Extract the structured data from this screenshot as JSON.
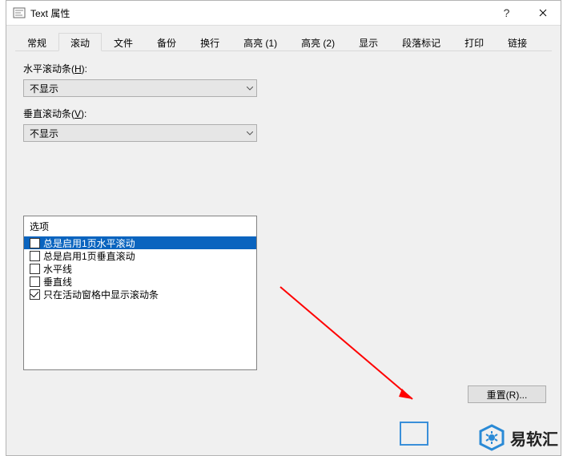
{
  "titlebar": {
    "title": "Text 属性"
  },
  "tabs": [
    {
      "label": "常规"
    },
    {
      "label": "滚动"
    },
    {
      "label": "文件"
    },
    {
      "label": "备份"
    },
    {
      "label": "换行"
    },
    {
      "label": "高亮 (1)"
    },
    {
      "label": "高亮 (2)"
    },
    {
      "label": "显示"
    },
    {
      "label": "段落标记"
    },
    {
      "label": "打印"
    },
    {
      "label": "链接"
    }
  ],
  "horizontal": {
    "label_before": "水平滚动条(",
    "accel": "H",
    "label_after": "):",
    "value": "不显示"
  },
  "vertical": {
    "label_before": "垂直滚动条(",
    "accel": "V",
    "label_after": "):",
    "value": "不显示"
  },
  "options": {
    "title": "选项",
    "items": [
      {
        "label": "总是启用1页水平滚动",
        "checked": false,
        "selected": true
      },
      {
        "label": "总是启用1页垂直滚动",
        "checked": false,
        "selected": false
      },
      {
        "label": "水平线",
        "checked": false,
        "selected": false
      },
      {
        "label": "垂直线",
        "checked": false,
        "selected": false
      },
      {
        "label": "只在活动窗格中显示滚动条",
        "checked": true,
        "selected": false
      }
    ]
  },
  "buttons": {
    "reset": "重置(R)..."
  },
  "watermark": {
    "text": "易软汇"
  }
}
